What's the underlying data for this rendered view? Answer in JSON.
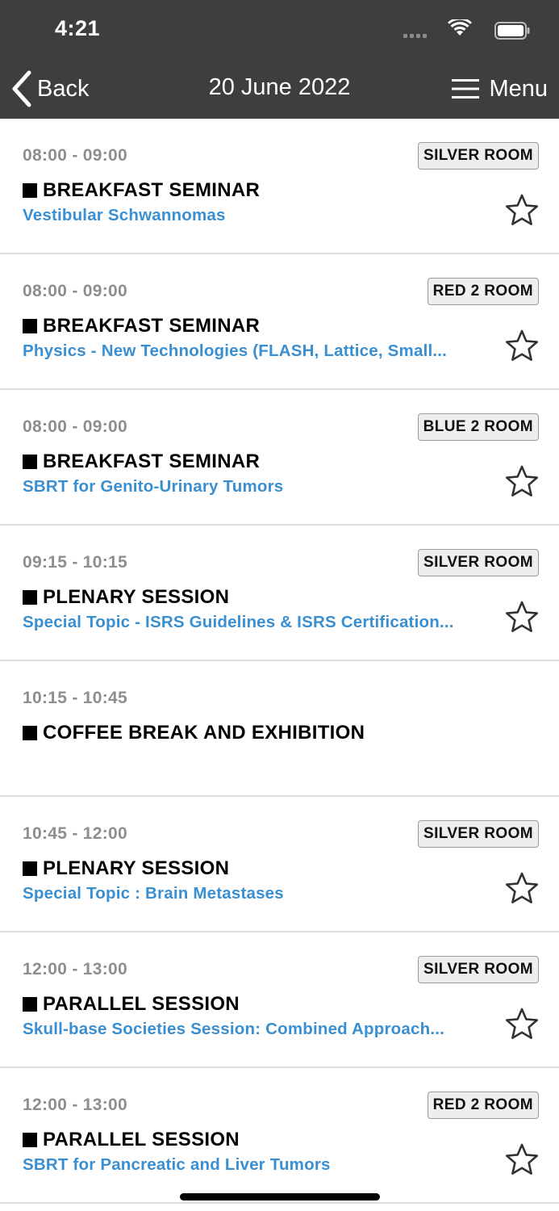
{
  "status_bar": {
    "time": "4:21"
  },
  "nav": {
    "back_label": "Back",
    "title": "20 June 2022",
    "menu_label": "Menu"
  },
  "colors": {
    "nav_bg": "#3e3e3e",
    "title_link": "#3a8fd0",
    "time_gray": "#8e8e8e"
  },
  "sessions": [
    {
      "time": "08:00 - 09:00",
      "room": "SILVER ROOM",
      "type": "BREAKFAST SEMINAR",
      "title": "Vestibular Schwannomas",
      "favorite": true
    },
    {
      "time": "08:00 - 09:00",
      "room": "RED 2 ROOM",
      "type": "BREAKFAST SEMINAR",
      "title": "Physics - New Technologies (FLASH, Lattice, Small...",
      "favorite": true
    },
    {
      "time": "08:00 - 09:00",
      "room": "BLUE 2 ROOM",
      "type": "BREAKFAST SEMINAR",
      "title": "SBRT for Genito-Urinary Tumors",
      "favorite": true
    },
    {
      "time": "09:15 - 10:15",
      "room": "SILVER ROOM",
      "type": "PLENARY SESSION",
      "title": "Special Topic - ISRS Guidelines & ISRS Certification...",
      "favorite": true
    },
    {
      "time": "10:15 - 10:45",
      "room": "",
      "type": "COFFEE BREAK AND EXHIBITION",
      "title": "",
      "favorite": false
    },
    {
      "time": "10:45 - 12:00",
      "room": "SILVER ROOM",
      "type": "PLENARY SESSION",
      "title": "Special Topic : Brain Metastases",
      "favorite": true
    },
    {
      "time": "12:00 - 13:00",
      "room": "SILVER ROOM",
      "type": "PARALLEL SESSION",
      "title": "Skull-base Societies Session: Combined Approach...",
      "favorite": true
    },
    {
      "time": "12:00 - 13:00",
      "room": "RED 2 ROOM",
      "type": "PARALLEL SESSION",
      "title": "SBRT for Pancreatic and Liver Tumors",
      "favorite": true
    }
  ]
}
